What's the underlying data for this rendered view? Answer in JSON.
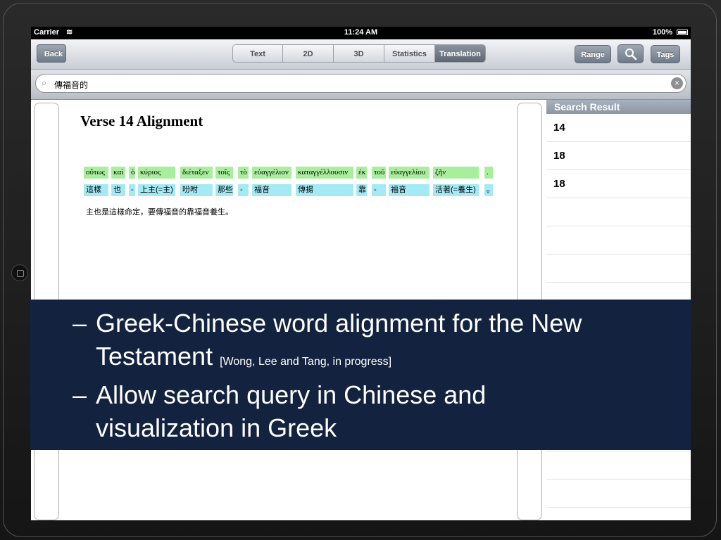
{
  "status_bar": {
    "carrier": "Carrier",
    "wifi_icon": "≋",
    "time": "11:24 AM",
    "battery": "100%"
  },
  "toolbar": {
    "back": "Back",
    "segments": [
      "Text",
      "2D",
      "3D",
      "Statistics",
      "Translation"
    ],
    "active_segment": "Translation",
    "range": "Range",
    "search_icon": "search-icon",
    "tags": "Tags"
  },
  "search": {
    "icon": "⌕",
    "value": "傳福音的",
    "clear_icon": "×"
  },
  "alignment": {
    "title": "Verse 14 Alignment",
    "greek": [
      "οὕτως",
      "καὶ",
      "ὁ",
      "κύριος",
      "διέταξεν",
      "τοῖς",
      "τὸ",
      "εὐαγγέλιον",
      "καταγγέλλουσιν",
      "ἐκ",
      "τοῦ",
      "εὐαγγελίου",
      "ζῆν",
      "."
    ],
    "chinese": [
      "這樣",
      "也",
      "-",
      "上主(=主)",
      "吩咐",
      "那些",
      "-",
      "福音",
      "傳揚",
      "靠",
      "-",
      "福音",
      "活著(=養生)",
      "。"
    ],
    "sentence": "主也是這樣命定，要傳福音的靠福音養生。"
  },
  "results": {
    "header": "Search Result",
    "items": [
      "14",
      "18",
      "18"
    ]
  },
  "overlay": {
    "bullet_dash": "–",
    "bullet1_line1": "Greek-Chinese word alignment for the New",
    "bullet1_line2": "Testament",
    "bullet1_citation": "[Wong, Lee and Tang, in progress]",
    "bullet2_line1": "Allow search query in Chinese and",
    "bullet2_line2": "visualization in Greek"
  }
}
